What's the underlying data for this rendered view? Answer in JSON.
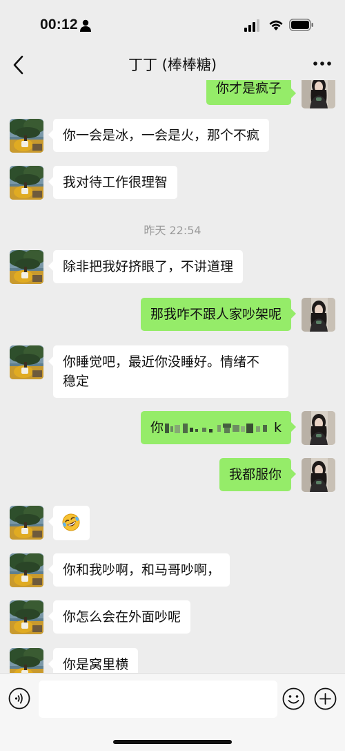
{
  "status_bar": {
    "time": "00:12"
  },
  "header": {
    "title": "丁丁 (棒棒糖)"
  },
  "chat": {
    "timestamp": "昨天 22:54",
    "messages": [
      {
        "side": "right",
        "text": "你才是疯子"
      },
      {
        "side": "left",
        "text": "你一会是冰，一会是火，那个不疯"
      },
      {
        "side": "left",
        "text": "我对待工作很理智"
      },
      {
        "side": "left",
        "text": "除非把我好挤眼了，不讲道理"
      },
      {
        "side": "right",
        "text": "那我咋不跟人家吵架呢"
      },
      {
        "side": "left",
        "line1": "你睡觉吧，最近你没睡好。情绪不",
        "line2": "稳定"
      },
      {
        "side": "right",
        "prefix": "你",
        "suffix": "k"
      },
      {
        "side": "right",
        "text": "我都服你"
      },
      {
        "side": "left",
        "text": ""
      },
      {
        "side": "left",
        "text": "你和我吵啊，和马哥吵啊，"
      },
      {
        "side": "left",
        "text": "你怎么会在外面吵呢"
      },
      {
        "side": "left",
        "text": "你是窝里横"
      }
    ]
  },
  "colors": {
    "sent_bubble": "#95ec69",
    "received_bubble": "#ffffff",
    "background": "#ededed"
  }
}
